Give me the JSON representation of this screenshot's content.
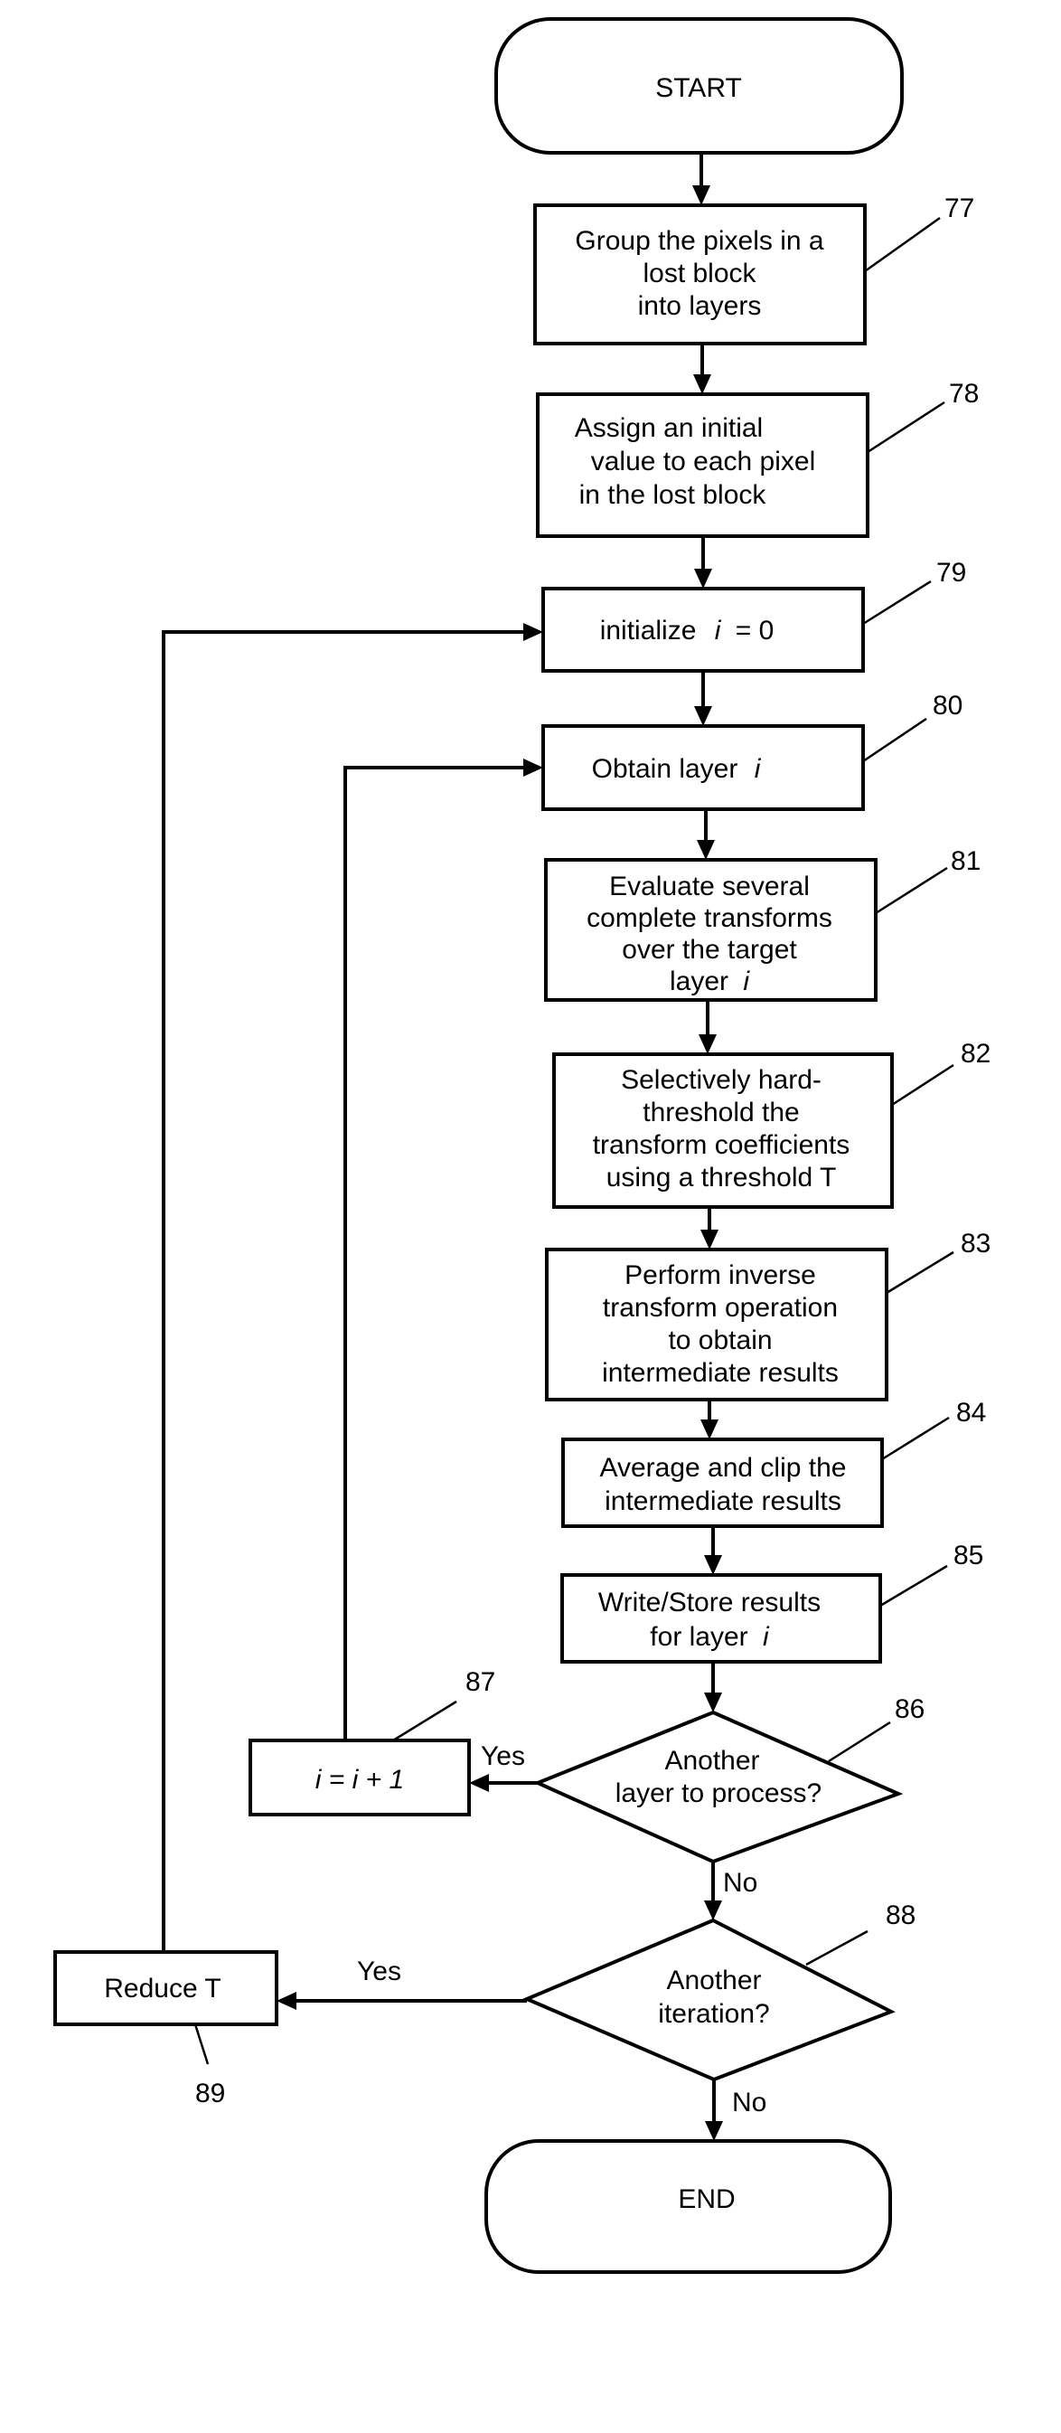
{
  "diagram": {
    "type": "flowchart",
    "start": {
      "label": "START"
    },
    "end": {
      "label": "END"
    },
    "steps": [
      {
        "ref": "77",
        "lines": [
          "Group the pixels in a",
          "lost block",
          "into layers"
        ]
      },
      {
        "ref": "78",
        "lines": [
          "Assign an initial",
          "value to each pixel",
          "in the lost block"
        ]
      },
      {
        "ref": "79",
        "text": "initialize",
        "var": "i",
        "suffix": "= 0"
      },
      {
        "ref": "80",
        "text": "Obtain layer",
        "var": "i"
      },
      {
        "ref": "81",
        "lines": [
          "Evaluate several",
          "complete transforms",
          "over the target"
        ],
        "last_text": "layer",
        "last_var": "i"
      },
      {
        "ref": "82",
        "lines": [
          "Selectively hard-",
          "threshold the",
          "transform coefficients",
          "using a threshold T"
        ]
      },
      {
        "ref": "83",
        "lines": [
          "Perform inverse",
          "transform operation",
          "to obtain",
          "intermediate results"
        ]
      },
      {
        "ref": "84",
        "lines": [
          "Average and clip the",
          "intermediate results"
        ]
      },
      {
        "ref": "85",
        "lines": [
          "Write/Store results"
        ],
        "last_text": "for layer",
        "last_var": "i"
      }
    ],
    "decisions": [
      {
        "ref": "86",
        "lines": [
          "Another",
          "layer to process?"
        ],
        "yes": "Yes",
        "no": "No"
      },
      {
        "ref": "88",
        "lines": [
          "Another",
          "iteration?"
        ],
        "yes": "Yes",
        "no": "No"
      }
    ],
    "increment": {
      "ref": "87",
      "label": "i = i + 1"
    },
    "reduce": {
      "ref": "89",
      "label": "Reduce T"
    }
  }
}
